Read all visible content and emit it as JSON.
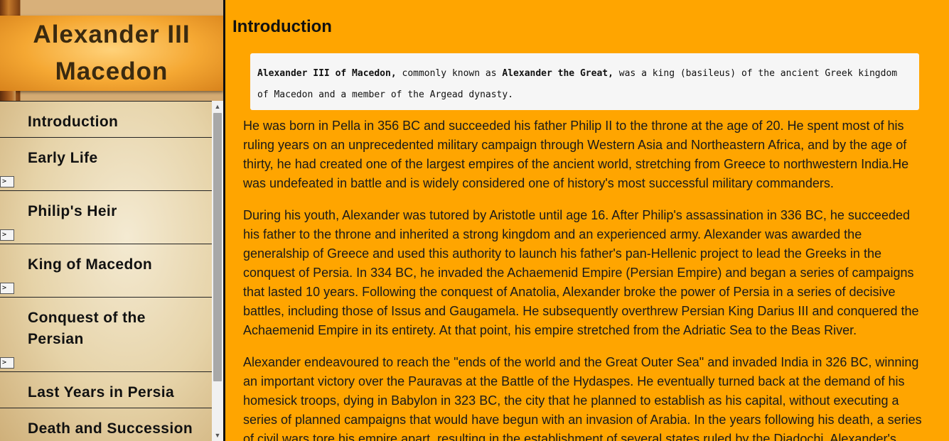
{
  "sidebar": {
    "title": "Alexander III Macedon",
    "items": [
      {
        "label": "Introduction"
      },
      {
        "label": "Early Life"
      },
      {
        "label": "Philip's Heir"
      },
      {
        "label": "King of Macedon"
      },
      {
        "label": "Conquest of the Persian"
      },
      {
        "label": "Last Years in Persia"
      },
      {
        "label": "Death and Succession"
      }
    ],
    "expander_label": ">",
    "scroll_up_icon": "▲",
    "scroll_down_icon": "▼"
  },
  "main": {
    "heading": "Introduction",
    "quote": {
      "name": "Alexander III of Macedon,",
      "mid": " commonly known as ",
      "alias": "Alexander the Great,",
      "rest": " was a king (basileus) of the ancient Greek kingdom of Macedon and a member of the Argead dynasty."
    },
    "paragraphs": [
      "He was born in Pella in 356 BC and succeeded his father Philip II to the throne at the age of 20. He spent most of his ruling years on an unprecedented military campaign through Western Asia and Northeastern Africa, and by the age of thirty, he had created one of the largest empires of the ancient world, stretching from Greece to northwestern India.He was undefeated in battle and is widely considered one of history's most successful military commanders.",
      "During his youth, Alexander was tutored by Aristotle until age 16. After Philip's assassination in 336 BC, he succeeded his father to the throne and inherited a strong kingdom and an experienced army. Alexander was awarded the generalship of Greece and used this authority to launch his father's pan-Hellenic project to lead the Greeks in the conquest of Persia. In 334 BC, he invaded the Achaemenid Empire (Persian Empire) and began a series of campaigns that lasted 10 years. Following the conquest of Anatolia, Alexander broke the power of Persia in a series of decisive battles, including those of Issus and Gaugamela. He subsequently overthrew Persian King Darius III and conquered the Achaemenid Empire in its entirety. At that point, his empire stretched from the Adriatic Sea to the Beas River.",
      "Alexander endeavoured to reach the \"ends of the world and the Great Outer Sea\" and invaded India in 326 BC, winning an important victory over the Pauravas at the Battle of the Hydaspes. He eventually turned back at the demand of his homesick troops, dying in Babylon in 323 BC, the city that he planned to establish as his capital, without executing a series of planned campaigns that would have begun with an invasion of Arabia. In the years following his death, a series of civil wars tore his empire apart, resulting in the establishment of several states ruled by the Diadochi, Alexander's"
    ]
  },
  "colors": {
    "page_background": "#ffa500",
    "banner": "#f5a833",
    "parchment": "#e6d3a8"
  }
}
